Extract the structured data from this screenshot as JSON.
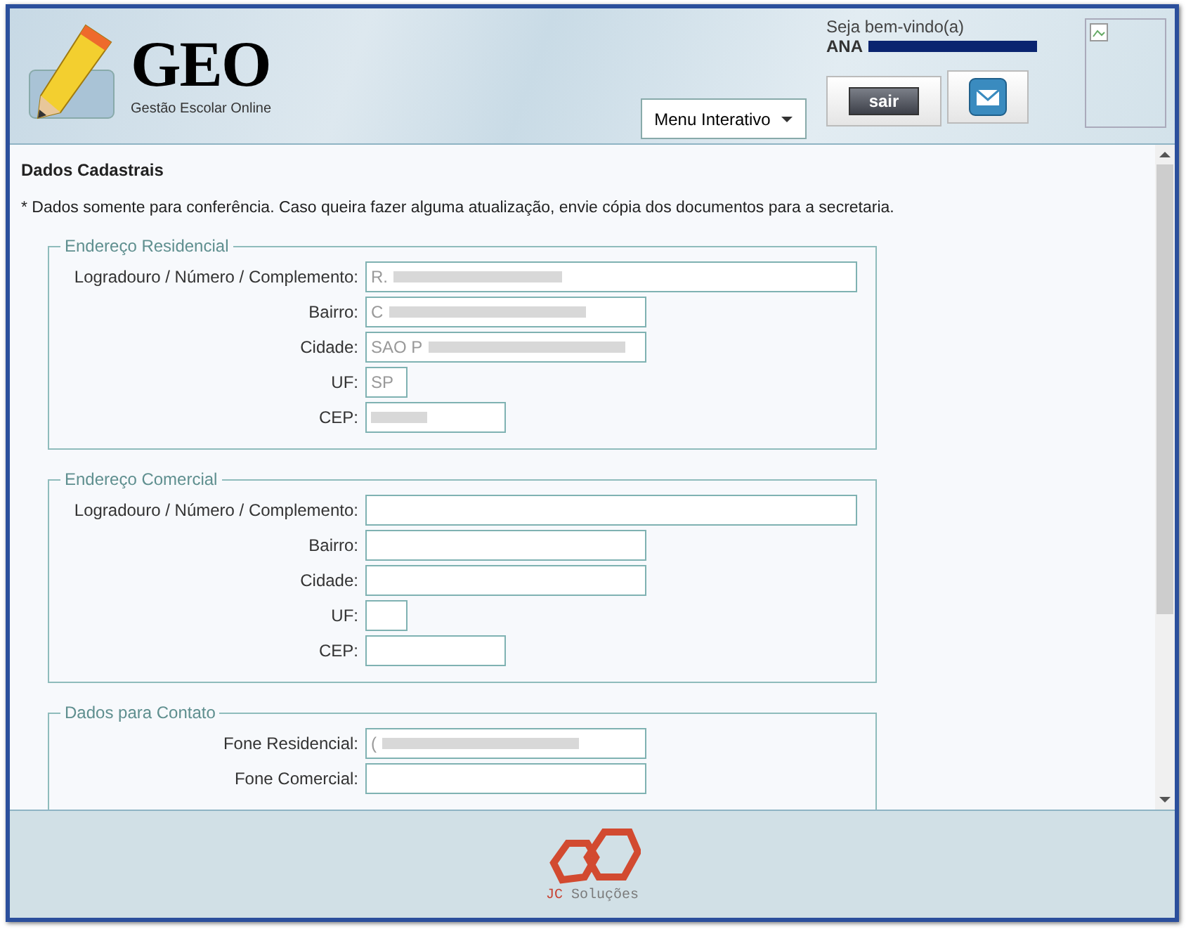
{
  "header": {
    "logo_title": "GEO",
    "logo_subtitle": "Gestão Escolar Online",
    "menu_button": "Menu Interativo",
    "welcome": "Seja bem-vindo(a)",
    "user_name": "ANA",
    "user_name_redacted": true,
    "logout_button": "sair"
  },
  "content": {
    "title": "Dados Cadastrais",
    "note": "* Dados somente para conferência. Caso queira fazer alguma atualização, envie cópia dos documentos para a secretaria.",
    "sections": [
      {
        "legend": "Endereço Residencial",
        "fields": [
          {
            "label": "Logradouro / Número / Complemento:",
            "value": "R.",
            "kind": "long",
            "redacted": true
          },
          {
            "label": "Bairro:",
            "value": "C",
            "kind": "medium",
            "redacted": true
          },
          {
            "label": "Cidade:",
            "value": "SAO P",
            "kind": "medium",
            "redacted": true
          },
          {
            "label": "UF:",
            "value": "SP",
            "kind": "tiny",
            "redacted": false
          },
          {
            "label": "CEP:",
            "kind": "short",
            "redacted": true
          }
        ]
      },
      {
        "legend": "Endereço Comercial",
        "fields": [
          {
            "label": "Logradouro / Número / Complemento:",
            "kind": "long",
            "redacted": false
          },
          {
            "label": "Bairro:",
            "kind": "medium",
            "redacted": false
          },
          {
            "label": "Cidade:",
            "kind": "medium",
            "redacted": false
          },
          {
            "label": "UF:",
            "kind": "tiny",
            "redacted": false
          },
          {
            "label": "CEP:",
            "kind": "short",
            "redacted": false
          }
        ]
      },
      {
        "legend": "Dados para Contato",
        "fields": [
          {
            "label": "Fone Residencial:",
            "value": "(",
            "kind": "medium",
            "redacted": true
          },
          {
            "label": "Fone Comercial:",
            "kind": "medium",
            "redacted": false
          }
        ]
      }
    ]
  },
  "footer": {
    "brand_initials": "JC",
    "brand_name": "Soluções"
  }
}
